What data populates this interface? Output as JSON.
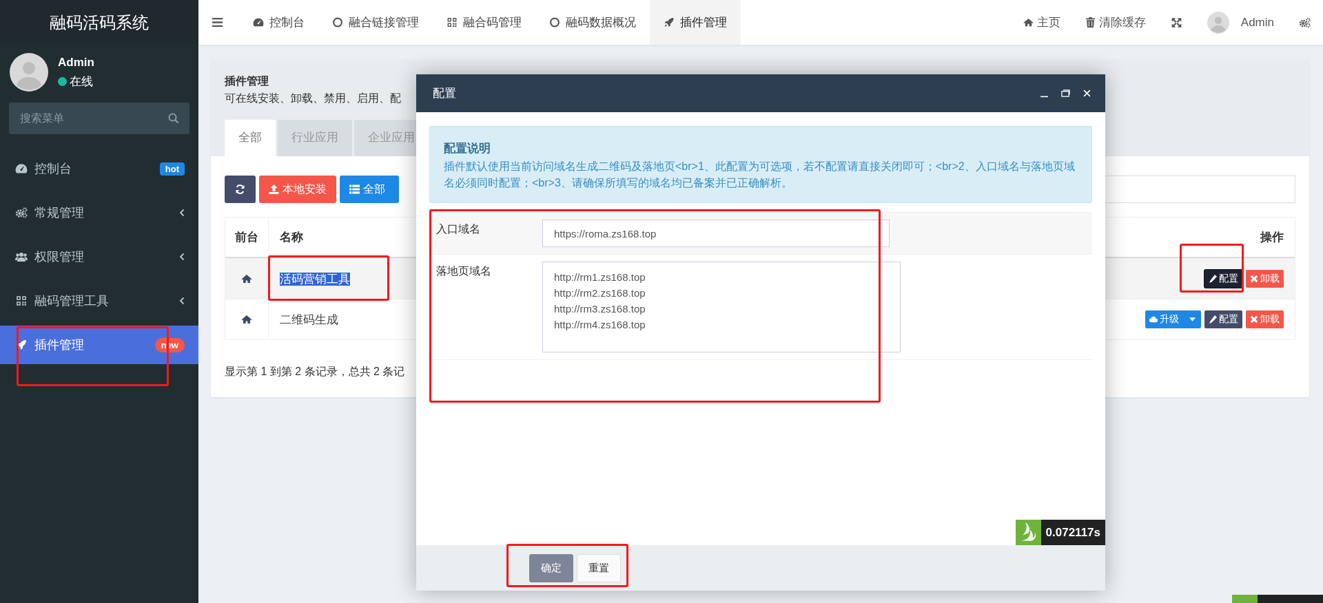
{
  "sidebar": {
    "logo": "融码活码系统",
    "user": {
      "name": "Admin",
      "status": "在线",
      "online": true
    },
    "search": {
      "placeholder": "搜索菜单"
    },
    "items": [
      {
        "label": "控制台",
        "kind": "dashboard",
        "badge": {
          "text": "hot",
          "color": "#1e88e5"
        },
        "has_children": false,
        "selected": false
      },
      {
        "label": "常规管理",
        "kind": "gears",
        "has_children": true,
        "selected": false
      },
      {
        "label": "权限管理",
        "kind": "users",
        "has_children": true,
        "selected": false
      },
      {
        "label": "融码管理工具",
        "kind": "qr",
        "has_children": true,
        "selected": false
      },
      {
        "label": "插件管理",
        "kind": "rocket",
        "badge": {
          "text": "new",
          "color": "#f4574a"
        },
        "has_children": false,
        "selected": true
      }
    ]
  },
  "topbar": {
    "tabs": [
      {
        "label": "控制台",
        "kind": "dashboard",
        "selected": false
      },
      {
        "label": "融合链接管理",
        "kind": "circle",
        "selected": false
      },
      {
        "label": "融合码管理",
        "kind": "qr",
        "selected": false
      },
      {
        "label": "融码数据概况",
        "kind": "circle",
        "selected": false
      },
      {
        "label": "插件管理",
        "kind": "rocket",
        "selected": true
      }
    ],
    "right": [
      {
        "kind": "home",
        "label": "主页"
      },
      {
        "kind": "trash",
        "label": "清除缓存"
      },
      {
        "kind": "fullscreen"
      },
      {
        "kind": "user",
        "label": "Admin"
      },
      {
        "kind": "gears"
      }
    ]
  },
  "panel": {
    "title": "插件管理",
    "subtitle": "可在线安装、卸载、禁用、启用、配",
    "tabs": [
      {
        "label": "全部",
        "selected": true
      },
      {
        "label": "行业应用",
        "selected": false
      },
      {
        "label": "企业应用",
        "selected": false
      }
    ],
    "toolbar": [
      {
        "kind": "refresh"
      },
      {
        "kind": "upload",
        "label": "本地安装"
      },
      {
        "kind": "list",
        "label": "全部"
      }
    ],
    "table": {
      "columns": [
        "前台",
        "名称",
        "操作"
      ],
      "rows": [
        {
          "name": "活码营销工具",
          "highlighted": true,
          "actions": [
            {
              "kind": "config",
              "label": "配置",
              "active": true
            },
            {
              "kind": "uninstall",
              "label": "卸载"
            }
          ]
        },
        {
          "name": "二维码生成",
          "highlighted": false,
          "actions": [
            {
              "kind": "upgrade",
              "label": "升级"
            },
            {
              "kind": "config",
              "label": "配置",
              "active": false
            },
            {
              "kind": "uninstall",
              "label": "卸载"
            }
          ]
        }
      ]
    },
    "footer": "显示第 1 到第 2 条记录，总共 2 条记"
  },
  "modal": {
    "title": "配置",
    "info": {
      "title": "配置说明",
      "text": "插件默认使用当前访问域名生成二维码及落地页<br>1、此配置为可选项，若不配置请直接关闭即可；<br>2、入口域名与落地页域名必须同时配置；<br>3、请确保所填写的域名均已备案并已正确解析。"
    },
    "fields": [
      {
        "kind": "input",
        "label": "入口域名",
        "value": "https://roma.zs168.top"
      },
      {
        "kind": "textarea",
        "label": "落地页域名",
        "value": "http://rm1.zs168.top\nhttp://rm2.zs168.top\nhttp://rm3.zs168.top\nhttp://rm4.zs168.top"
      }
    ],
    "buttons": [
      {
        "kind": "primary",
        "label": "确定"
      },
      {
        "kind": "default",
        "label": "重置"
      }
    ],
    "timer": "0.072117s"
  }
}
